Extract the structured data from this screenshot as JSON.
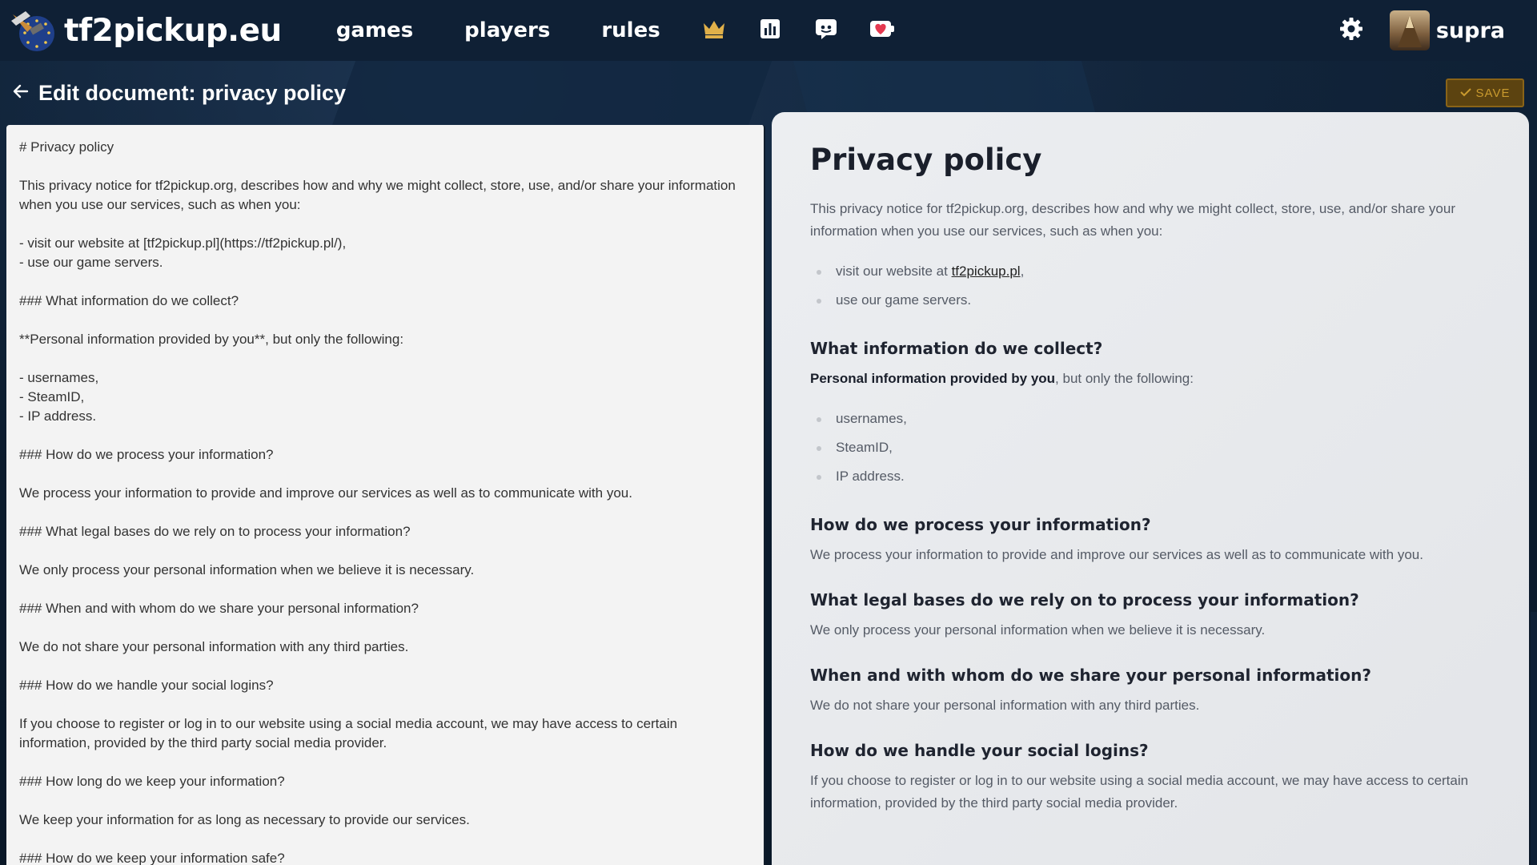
{
  "nav": {
    "brand": "tf2pickup.eu",
    "links": [
      "games",
      "players",
      "rules"
    ],
    "icons": [
      "crown-icon",
      "stats-icon",
      "discord-icon",
      "donate-icon"
    ],
    "username": "supra",
    "settings_icon": "gear-icon"
  },
  "header": {
    "title": "Edit document: privacy policy",
    "save_label": "SAVE"
  },
  "editor": {
    "content": "# Privacy policy\n\nThis privacy notice for tf2pickup.org, describes how and why we might collect, store, use, and/or share your information when you use our services, such as when you:\n\n- visit our website at [tf2pickup.pl](https://tf2pickup.pl/),\n- use our game servers.\n\n### What information do we collect?\n\n**Personal information provided by you**, but only the following:\n\n- usernames,\n- SteamID,\n- IP address.\n\n### How do we process your information?\n\nWe process your information to provide and improve our services as well as to communicate with you.\n\n### What legal bases do we rely on to process your information?\n\nWe only process your personal information when we believe it is necessary.\n\n### When and with whom do we share your personal information?\n\nWe do not share your personal information with any third parties.\n\n### How do we handle your social logins?\n\nIf you choose to register or log in to our website using a social media account, we may have access to certain information, provided by the third party social media provider.\n\n### How long do we keep your information?\n\nWe keep your information for as long as necessary to provide our services.\n\n### How do we keep your information safe?"
  },
  "preview": {
    "title": "Privacy policy",
    "intro": "This privacy notice for tf2pickup.org, describes how and why we might collect, store, use, and/or share your information when you use our services, such as when you:",
    "visit_prefix": "visit our website at ",
    "visit_link": "tf2pickup.pl",
    "visit_suffix": ",",
    "servers": "use our game servers.",
    "h_collect": "What information do we collect?",
    "collect_bold": "Personal information provided by you",
    "collect_rest": ", but only the following:",
    "collect_items": [
      "usernames,",
      "SteamID,",
      "IP address."
    ],
    "h_process": "How do we process your information?",
    "process_text": "We process your information to provide and improve our services as well as to communicate with you.",
    "h_legal": "What legal bases do we rely on to process your information?",
    "legal_text": "We only process your personal information when we believe it is necessary.",
    "h_share": "When and with whom do we share your personal information?",
    "share_text": "We do not share your personal information with any third parties.",
    "h_social": "How do we handle your social logins?",
    "social_text": "If you choose to register or log in to our website using a social media account, we may have access to certain information, provided by the third party social media provider."
  }
}
